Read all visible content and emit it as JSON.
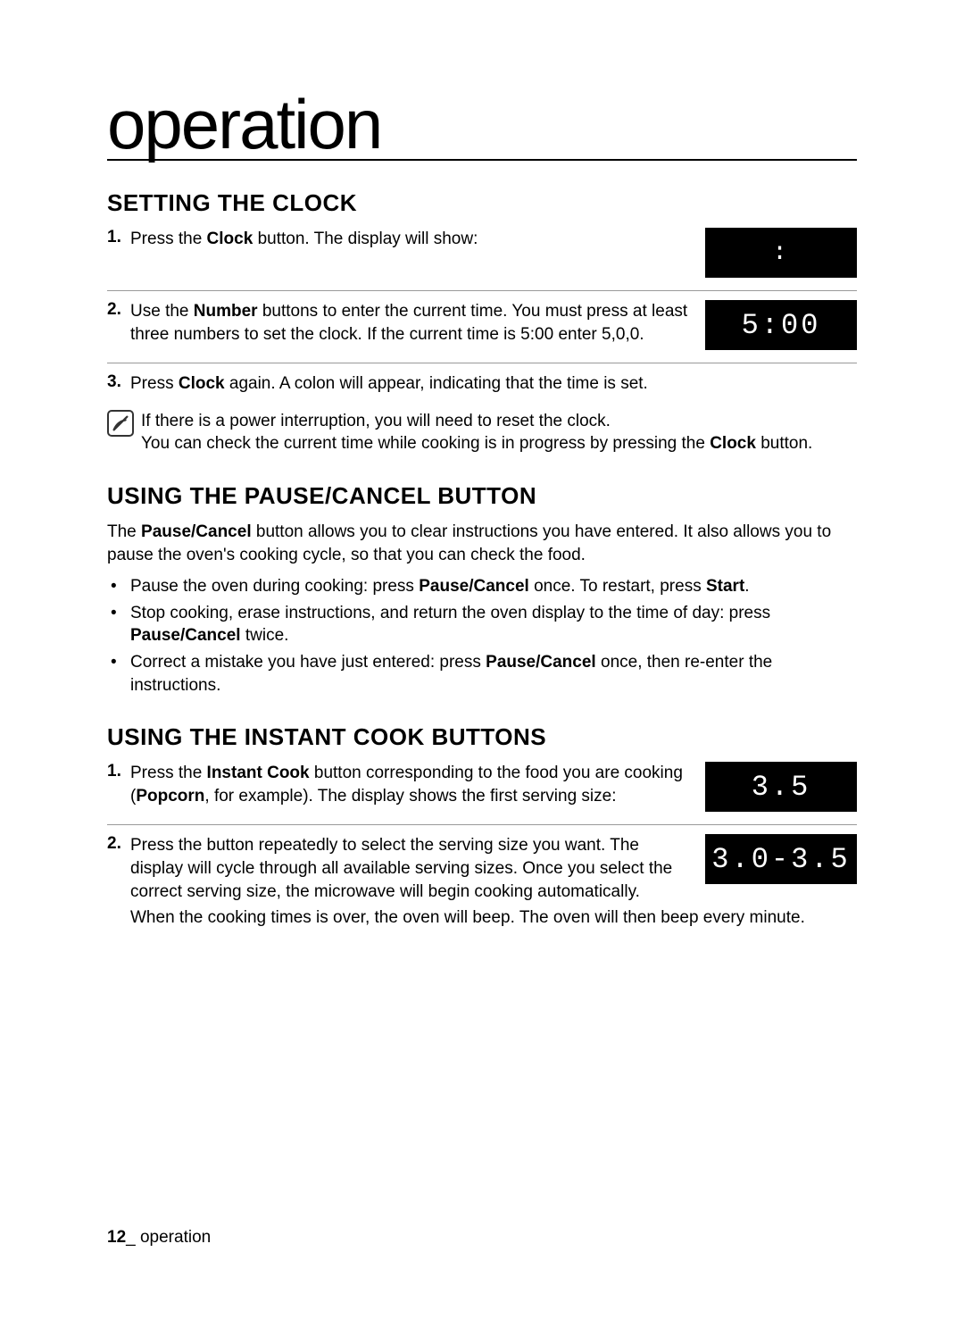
{
  "page": {
    "title": "operation",
    "footer_page": "12",
    "footer_section": "_ operation"
  },
  "section1": {
    "heading": "SETTING THE CLOCK",
    "step1_num": "1.",
    "step1_pre": "Press the ",
    "step1_bold": "Clock",
    "step1_post": " button. The display will show:",
    "display1": ":",
    "step2_num": "2.",
    "step2_pre": "Use the ",
    "step2_bold": "Number",
    "step2_post": " buttons to enter the current time. You must press at least three numbers to set the clock. If the current time is 5:00 enter 5,0,0.",
    "display2": "5:00",
    "step3_num": "3.",
    "step3_pre": "Press ",
    "step3_bold": "Clock",
    "step3_post": " again. A colon will appear, indicating that the time is set.",
    "note_line1": "If there is a power interruption, you will need to reset the clock.",
    "note_line2_pre": "You can check the current time while cooking is in progress by pressing the ",
    "note_line2_bold": "Clock",
    "note_line2_post": " button."
  },
  "section2": {
    "heading": "USING THE PAUSE/CANCEL BUTTON",
    "intro_pre": "The ",
    "intro_bold": "Pause/Cancel",
    "intro_post": " button allows you to clear instructions you have entered. It also allows you to pause the oven's cooking cycle, so that you can check the food.",
    "b1_pre": "Pause the oven during cooking: press ",
    "b1_bold1": "Pause/Cancel",
    "b1_mid": " once. To restart, press ",
    "b1_bold2": "Start",
    "b1_post": ".",
    "b2_pre": "Stop cooking, erase instructions, and return the oven display to the time of day: press ",
    "b2_bold": "Pause/Cancel",
    "b2_post": " twice.",
    "b3_pre": "Correct a mistake you have just entered: press ",
    "b3_bold": "Pause/Cancel",
    "b3_post": " once, then re-enter the instructions."
  },
  "section3": {
    "heading": "USING THE INSTANT COOK BUTTONS",
    "step1_num": "1.",
    "step1_pre": "Press the ",
    "step1_bold1": "Instant Cook",
    "step1_mid": " button corresponding to the food you are cooking (",
    "step1_bold2": "Popcorn",
    "step1_post": ", for example). The display shows the first serving size:",
    "display1": "3.5",
    "step2_num": "2.",
    "step2_text": "Press the button repeatedly to select the serving size you want. The display will cycle through all available serving sizes. Once you select the correct serving size, the microwave will begin cooking automatically.",
    "display2": "3.0-3.5",
    "cont": "When the cooking times is over, the oven will beep. The oven will then beep every minute."
  }
}
